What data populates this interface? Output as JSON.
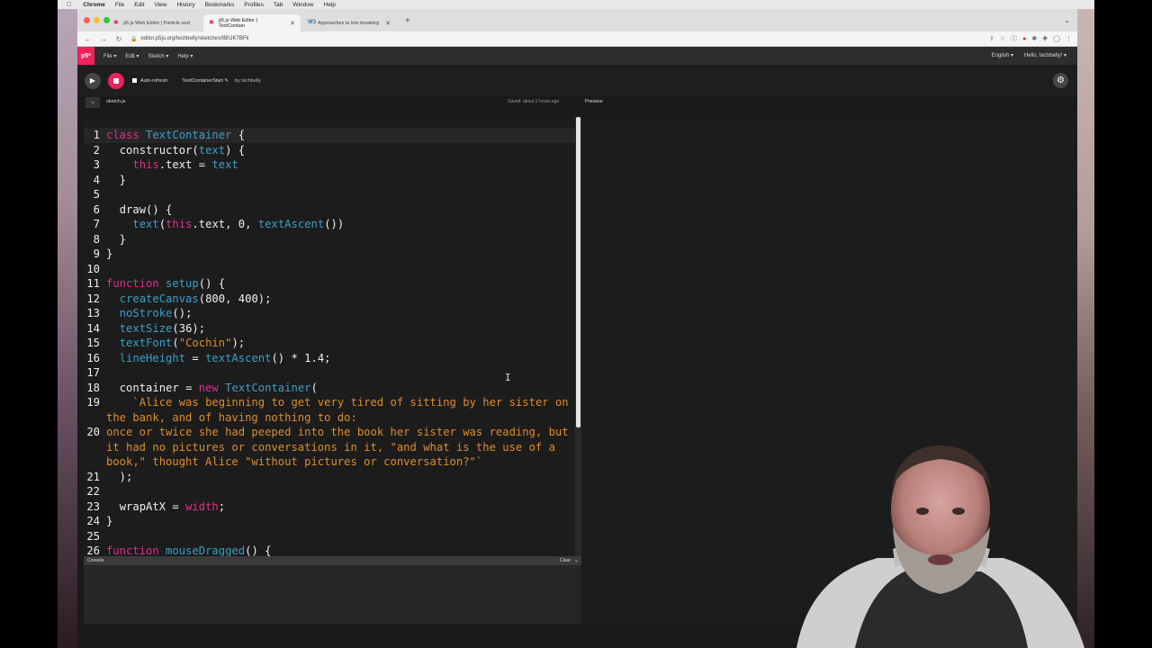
{
  "menubar": {
    "items": [
      "Chrome",
      "File",
      "Edit",
      "View",
      "History",
      "Bookmarks",
      "Profiles",
      "Tab",
      "Window",
      "Help"
    ]
  },
  "browser": {
    "tabs": [
      {
        "label": "p5.js Web Editor | Particle and",
        "active": false,
        "icon": "p5-star-icon"
      },
      {
        "label": "p5.js Web Editor | TextContain",
        "active": true,
        "icon": "p5-star-icon"
      },
      {
        "label": "Approaches to line breaking",
        "active": false,
        "icon": "w3-icon"
      }
    ],
    "url": "editor.p5js.org/techbelly/sketches/tBhJK7BFk"
  },
  "p5": {
    "logo": "p5*",
    "menu": [
      "File ▾",
      "Edit ▾",
      "Sketch ▾",
      "Help ▾"
    ],
    "language": "English ▾",
    "user": "Hello, techbelly! ▾",
    "auto_refresh": "Auto-refresh",
    "sketch_name": "TextContainerStart ✎",
    "by_user": "by techbelly",
    "file_name": "sketch.js",
    "saved_status": "Saved: about 2 hours ago",
    "preview_label": "Preview",
    "console_title": "Console",
    "console_clear": "Clear"
  },
  "code": {
    "lines": [
      {
        "n": "1",
        "text": "class TextContainer {"
      },
      {
        "n": "2",
        "text": "  constructor(text) {"
      },
      {
        "n": "3",
        "text": "    this.text = text"
      },
      {
        "n": "4",
        "text": "  }"
      },
      {
        "n": "5",
        "text": ""
      },
      {
        "n": "6",
        "text": "  draw() {"
      },
      {
        "n": "7",
        "text": "    text(this.text, 0, textAscent())"
      },
      {
        "n": "8",
        "text": "  }"
      },
      {
        "n": "9",
        "text": "}"
      },
      {
        "n": "10",
        "text": ""
      },
      {
        "n": "11",
        "text": "function setup() {"
      },
      {
        "n": "12",
        "text": "  createCanvas(800, 400);"
      },
      {
        "n": "13",
        "text": "  noStroke();"
      },
      {
        "n": "14",
        "text": "  textSize(36);"
      },
      {
        "n": "15",
        "text": "  textFont(\"Cochin\");"
      },
      {
        "n": "16",
        "text": "  lineHeight = textAscent() * 1.4;"
      },
      {
        "n": "17",
        "text": ""
      },
      {
        "n": "18",
        "text": "  container = new TextContainer("
      },
      {
        "n": "19",
        "text": "    `Alice was beginning to get very tired of sitting by her sister on"
      },
      {
        "n": "",
        "text": "the bank, and of having nothing to do:"
      },
      {
        "n": "20",
        "text": "once or twice she had peeped into the book her sister was reading, but"
      },
      {
        "n": "",
        "text": "it had no pictures or conversations in it, \"and what is the use of a"
      },
      {
        "n": "",
        "text": "book,\" thought Alice \"without pictures or conversation?\"`"
      },
      {
        "n": "21",
        "text": "  );"
      },
      {
        "n": "22",
        "text": ""
      },
      {
        "n": "23",
        "text": "  wrapAtX = width;"
      },
      {
        "n": "24",
        "text": "}"
      },
      {
        "n": "25",
        "text": ""
      },
      {
        "n": "26",
        "text": "function mouseDragged() {"
      }
    ]
  },
  "colors": {
    "p5_pink": "#ed225d",
    "keyword": "#d9328a",
    "function": "#3c9fc8",
    "string": "#de8c2e",
    "editor_bg": "#1c1c1c"
  }
}
